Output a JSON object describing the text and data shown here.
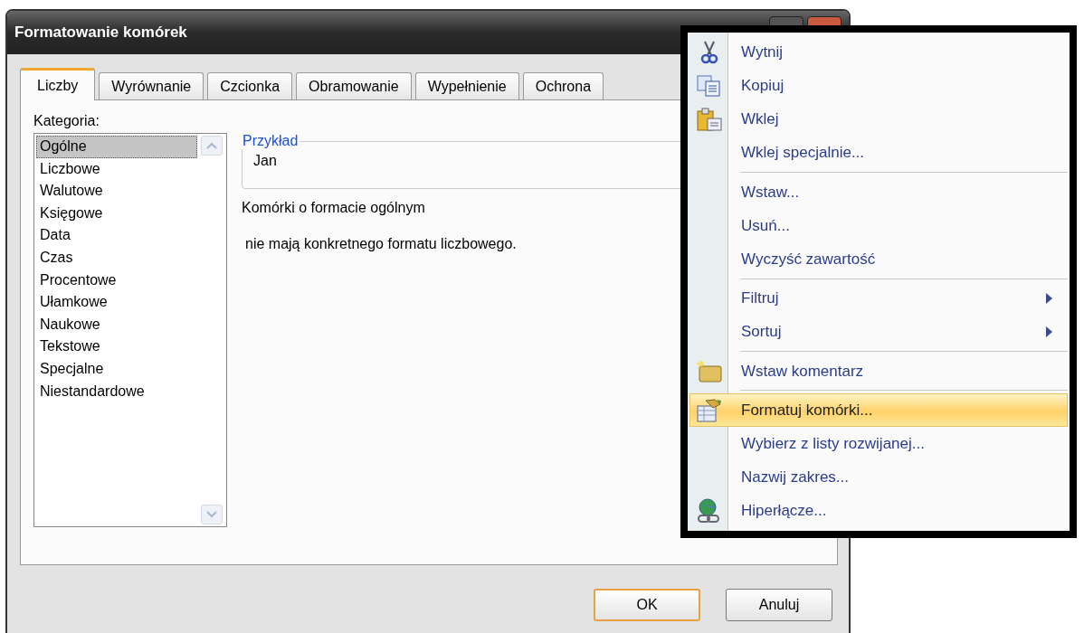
{
  "window": {
    "title": "Formatowanie komórek"
  },
  "tabs": [
    {
      "label": "Liczby",
      "selected": true
    },
    {
      "label": "Wyrównanie",
      "selected": false
    },
    {
      "label": "Czcionka",
      "selected": false
    },
    {
      "label": "Obramowanie",
      "selected": false
    },
    {
      "label": "Wypełnienie",
      "selected": false
    },
    {
      "label": "Ochrona",
      "selected": false
    }
  ],
  "category": {
    "label": "Kategoria:",
    "items": [
      {
        "label": "Ogólne",
        "selected": true
      },
      {
        "label": "Liczbowe",
        "selected": false
      },
      {
        "label": "Walutowe",
        "selected": false
      },
      {
        "label": "Księgowe",
        "selected": false
      },
      {
        "label": "Data",
        "selected": false
      },
      {
        "label": "Czas",
        "selected": false
      },
      {
        "label": "Procentowe",
        "selected": false
      },
      {
        "label": "Ułamkowe",
        "selected": false
      },
      {
        "label": "Naukowe",
        "selected": false
      },
      {
        "label": "Tekstowe",
        "selected": false
      },
      {
        "label": "Specjalne",
        "selected": false
      },
      {
        "label": "Niestandardowe",
        "selected": false
      }
    ]
  },
  "sample": {
    "legend": "Przykład",
    "value": "Jan"
  },
  "description": [
    "Komórki o formacie ogólnym",
    "nie mają konkretnego formatu liczbowego."
  ],
  "buttons": [
    {
      "label": "OK",
      "default": true
    },
    {
      "label": "Anuluj",
      "default": false
    }
  ],
  "context_menu": {
    "groups": [
      {
        "items": [
          {
            "label": "Wytnij",
            "submenu": false,
            "selected": false
          },
          {
            "label": "Kopiuj",
            "submenu": false,
            "selected": false
          },
          {
            "label": "Wklej",
            "submenu": false,
            "selected": false
          },
          {
            "label": "Wklej specjalnie...",
            "submenu": false,
            "selected": false
          }
        ]
      },
      {
        "items": [
          {
            "label": "Wstaw...",
            "submenu": false,
            "selected": false
          },
          {
            "label": "Usuń...",
            "submenu": false,
            "selected": false
          },
          {
            "label": "Wyczyść zawartość",
            "submenu": false,
            "selected": false
          }
        ]
      },
      {
        "items": [
          {
            "label": "Filtruj",
            "submenu": true,
            "selected": false
          },
          {
            "label": "Sortuj",
            "submenu": true,
            "selected": false
          }
        ]
      },
      {
        "items": [
          {
            "label": "Wstaw komentarz",
            "submenu": false,
            "selected": false
          }
        ]
      },
      {
        "items": [
          {
            "label": "Formatuj komórki...",
            "submenu": false,
            "selected": true
          },
          {
            "label": "Wybierz z listy rozwijanej...",
            "submenu": false,
            "selected": false
          },
          {
            "label": "Nazwij zakres...",
            "submenu": false,
            "selected": false
          },
          {
            "label": "Hiperłącze...",
            "submenu": false,
            "selected": false
          }
        ]
      }
    ]
  }
}
